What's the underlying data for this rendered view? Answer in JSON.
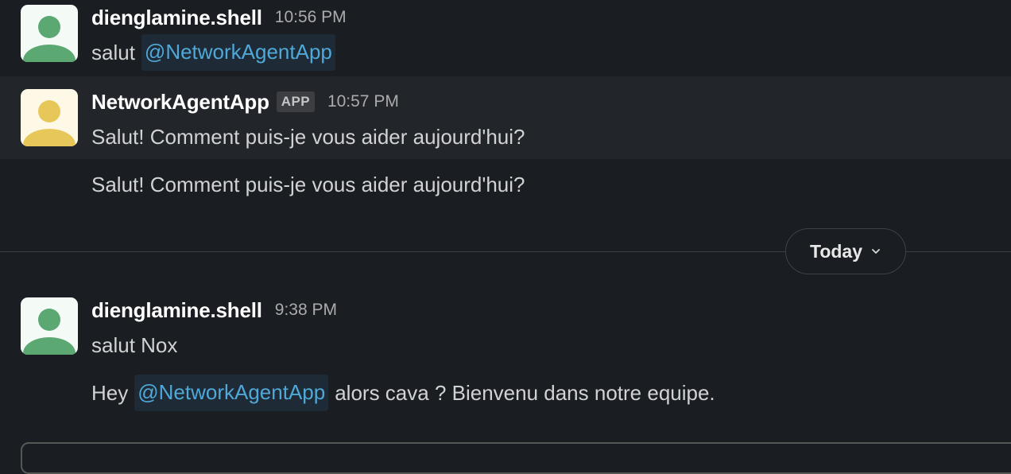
{
  "messages": [
    {
      "author": "dienglamine.shell",
      "time": "10:56 PM",
      "text_before": "salut",
      "mention": "@NetworkAgentApp"
    },
    {
      "author": "NetworkAgentApp",
      "badge": "APP",
      "time": "10:57 PM",
      "text": "Salut! Comment puis-je vous aider aujourd'hui?",
      "followup": "Salut! Comment puis-je vous aider aujourd'hui?"
    },
    {
      "author": "dienglamine.shell",
      "time": "9:38 PM",
      "text": "salut Nox",
      "followup_before": "Hey",
      "followup_mention": "@NetworkAgentApp",
      "followup_after": "alors cava ? Bienvenu dans notre equipe."
    }
  ],
  "date_divider": {
    "label": "Today"
  },
  "colors": {
    "background": "#1a1d21",
    "highlight": "#222529",
    "mention_text": "#4fa8d8",
    "mention_bg": "#1e2b36",
    "user_avatar": "#5ba873",
    "app_avatar": "#e8c75a"
  },
  "icons": {
    "user_avatar": "person-avatar-icon",
    "app_avatar": "person-avatar-icon",
    "divider_chevron": "chevron-down-icon"
  }
}
